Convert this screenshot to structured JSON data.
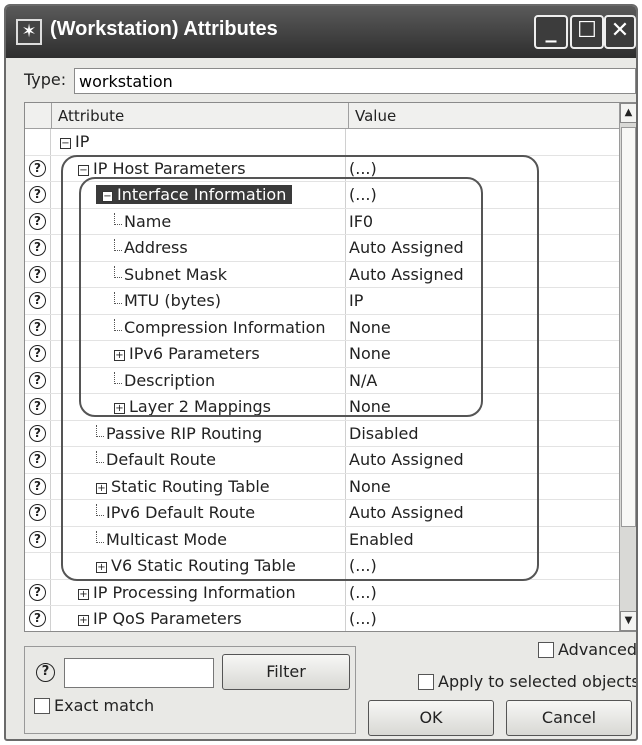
{
  "window": {
    "title": "(Workstation) Attributes",
    "icon": "star-icon"
  },
  "type": {
    "label": "Type:",
    "value": "workstation"
  },
  "grid": {
    "headers": {
      "attribute": "Attribute",
      "value": "Value"
    },
    "rows": [
      {
        "attr": "IP",
        "value": "",
        "help": false,
        "indent": 0,
        "marker": "collapse"
      },
      {
        "attr": "IP Host Parameters",
        "value": "(...)",
        "help": true,
        "indent": 1,
        "marker": "collapse"
      },
      {
        "attr": "Interface Information",
        "value": "(...)",
        "help": true,
        "indent": 2,
        "marker": "collapse",
        "selected": true
      },
      {
        "attr": "Name",
        "value": "IF0",
        "help": true,
        "indent": 3,
        "marker": "line"
      },
      {
        "attr": "Address",
        "value": "Auto Assigned",
        "help": true,
        "indent": 3,
        "marker": "line"
      },
      {
        "attr": "Subnet Mask",
        "value": "Auto Assigned",
        "help": true,
        "indent": 3,
        "marker": "line"
      },
      {
        "attr": "MTU (bytes)",
        "value": "IP",
        "help": true,
        "indent": 3,
        "marker": "line"
      },
      {
        "attr": "Compression Information",
        "value": "None",
        "help": true,
        "indent": 3,
        "marker": "line"
      },
      {
        "attr": "IPv6 Parameters",
        "value": "None",
        "help": true,
        "indent": 3,
        "marker": "expand"
      },
      {
        "attr": "Description",
        "value": "N/A",
        "help": true,
        "indent": 3,
        "marker": "line"
      },
      {
        "attr": "Layer 2 Mappings",
        "value": "None",
        "help": true,
        "indent": 3,
        "marker": "expand"
      },
      {
        "attr": "Passive RIP Routing",
        "value": "Disabled",
        "help": true,
        "indent": 2,
        "marker": "line"
      },
      {
        "attr": "Default Route",
        "value": "Auto Assigned",
        "help": true,
        "indent": 2,
        "marker": "line"
      },
      {
        "attr": "Static Routing Table",
        "value": "None",
        "help": true,
        "indent": 2,
        "marker": "expand"
      },
      {
        "attr": "IPv6 Default Route",
        "value": "Auto Assigned",
        "help": true,
        "indent": 2,
        "marker": "line"
      },
      {
        "attr": "Multicast Mode",
        "value": "Enabled",
        "help": true,
        "indent": 2,
        "marker": "line"
      },
      {
        "attr": "V6 Static Routing Table",
        "value": "(...)",
        "help": false,
        "indent": 2,
        "marker": "expand"
      },
      {
        "attr": "IP Processing Information",
        "value": "(...)",
        "help": true,
        "indent": 1,
        "marker": "expand"
      },
      {
        "attr": "IP QoS Parameters",
        "value": "(...)",
        "help": true,
        "indent": 1,
        "marker": "expand"
      }
    ]
  },
  "footer": {
    "help_glyph": "?",
    "filter_label": "Filter",
    "filter_value": "",
    "exact_match_label": "Exact match",
    "exact_match_checked": false,
    "advanced_label": "Advanced",
    "advanced_checked": false,
    "apply_label": "Apply to selected objects",
    "apply_checked": false,
    "ok_label": "OK",
    "cancel_label": "Cancel"
  },
  "icons": {
    "help": "question-circle-icon",
    "collapse": "minus-box-icon",
    "expand": "plus-box-icon",
    "minimize": "minimize-icon",
    "maximize": "maximize-icon",
    "close": "close-icon",
    "scroll_up": "arrow-up-icon",
    "scroll_down": "arrow-down-icon"
  }
}
